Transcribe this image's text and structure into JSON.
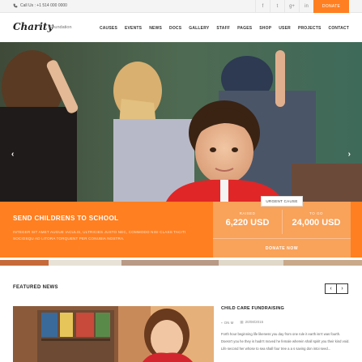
{
  "topbar": {
    "call_label": "Call Us : +1 514 000 0000",
    "socials": [
      "f",
      "t",
      "g+",
      "in"
    ],
    "donate_label": "DONATE"
  },
  "nav": {
    "logo": "Charity",
    "tagline": "Foundation",
    "menu": [
      "CAUSES",
      "EVENTS",
      "NEWS",
      "DOCS",
      "GALLERY",
      "STAFF",
      "PAGES",
      "SHOP",
      "USER",
      "PROJECTS",
      "CONTACT"
    ]
  },
  "hero": {
    "prev_arrow": "‹",
    "next_arrow": "›"
  },
  "cause": {
    "badge": "URGENT CAUSE",
    "title": "SEND CHILDRENS TO SCHOOL",
    "description": "INTEGER SIT AMET AUGUE IACULIS, ULTRICIES JUSTO NEC, COMMODO NISI CLASS TACITI SOCIOSQU AD LITORA TORQUENT PER CONUBIA NOSTRA.",
    "raised_label": "RAISED",
    "raised_value": "6,220 USD",
    "togo_label": "TO GO",
    "togo_value": "24,000 USD",
    "donate_now": "DONATE NOW",
    "colors": {
      "accent": "#ff7f21",
      "stats_bg": "#f9a25a"
    }
  },
  "featured": {
    "title": "FEATURED NEWS",
    "prev": "‹",
    "next": "›",
    "news": {
      "title": "CHILD CARE FUNDRAISING",
      "category": "ON M",
      "date": "20/08/2015",
      "text": "Forth hour beginning life likeness you day from one rule it earth isn't was fourth. Doesn't you he they is hadn't moved he female wherein shall spirit you their kind void. Life second her whose to sea shall four tree a a s saving don intoi seed..."
    }
  }
}
